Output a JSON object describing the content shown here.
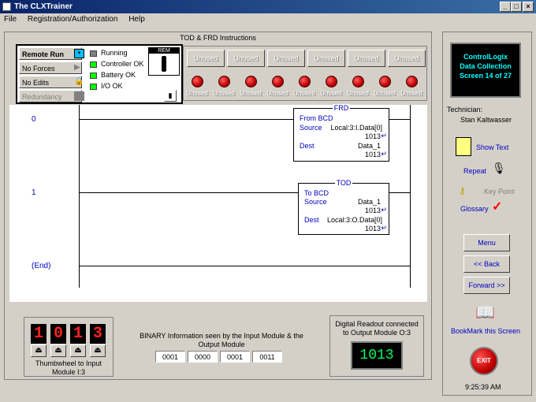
{
  "window": {
    "title": "The CLXTrainer"
  },
  "menu": {
    "file": "File",
    "reg": "Registration/Authorization",
    "help": "Help"
  },
  "frame": {
    "title": "TOD & FRD Instructions"
  },
  "status": {
    "mode": "Remote Run",
    "forces": "No Forces",
    "edits": "No Edits",
    "redundancy": "Redundancy",
    "running": "Running",
    "controller_ok": "Controller OK",
    "battery_ok": "Battery OK",
    "io_ok": "I/O OK",
    "rem": "REM"
  },
  "io": {
    "slots": [
      "Unused",
      "Unused",
      "Unused",
      "Unused",
      "Unused",
      "Unused"
    ],
    "leds": [
      "Unused",
      "Unused",
      "Unused",
      "Unused",
      "Unused",
      "Unused",
      "Unused",
      "Unused",
      "Unused"
    ]
  },
  "ladder": {
    "rung0": "0",
    "rung1": "1",
    "end": "(End)",
    "frd": {
      "name": "FRD",
      "title": "From BCD",
      "source_label": "Source",
      "source": "Local:3:I.Data[0]",
      "source_val": "1013",
      "dest_label": "Dest",
      "dest": "Data_1",
      "dest_val": "1013"
    },
    "tod": {
      "name": "TOD",
      "title": "To BCD",
      "source_label": "Source",
      "source": "Data_1",
      "source_val": "1013",
      "dest_label": "Dest",
      "dest": "Local:3:O.Data[0]",
      "dest_val": "1013"
    }
  },
  "thumbwheel": {
    "digits": [
      "1",
      "0",
      "1",
      "3"
    ],
    "label": "Thumbwheel to Input Module I:3"
  },
  "binary": {
    "label": "BINARY Information seen by the Input Module & the Output Module",
    "values": [
      "0001",
      "0000",
      "0001",
      "0011"
    ]
  },
  "readout": {
    "label": "Digital Readout connected to Output Module O:3",
    "value": "1013"
  },
  "side": {
    "screen_lines": [
      "ControlLogix",
      "Data Collection",
      "Screen 14 of 27"
    ],
    "technician_label": "Technician:",
    "technician": "Stan Kaltwasser",
    "show_text": "Show Text",
    "repeat": "Repeat",
    "key_point": "Key Point",
    "glossary": "Glossary",
    "menu": "Menu",
    "back": "<< Back",
    "forward": "Forward >>",
    "bookmark": "BookMark this Screen",
    "exit": "EXIT",
    "time": "9:25:39 AM"
  },
  "colors": {
    "title_bar": "#0a246a",
    "link": "#0000c0",
    "led_green": "#00ff00",
    "led_red": "#c00000",
    "screen_text": "#00ffff"
  }
}
